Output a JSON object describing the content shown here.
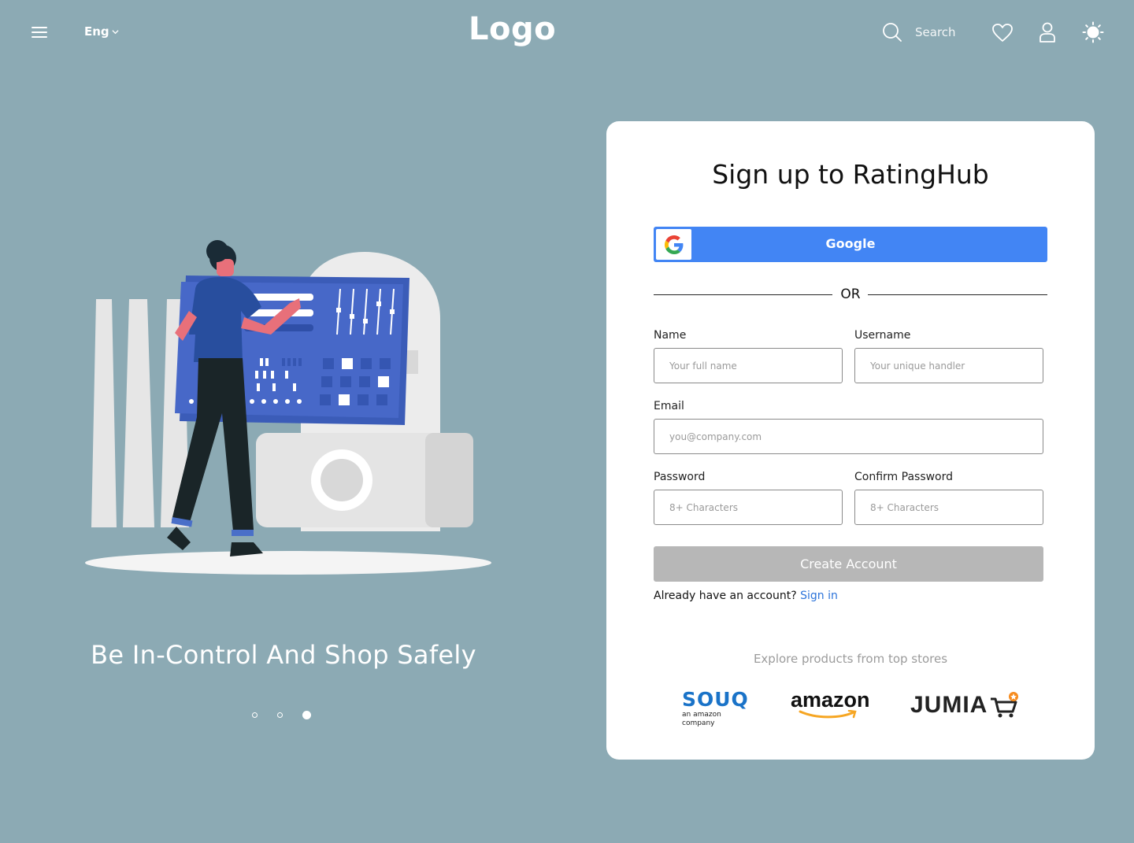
{
  "header": {
    "language": "Eng",
    "logo": "Logo",
    "search_placeholder": "Search"
  },
  "hero": {
    "title": "Be In-Control And Shop Safely",
    "carousel": {
      "total": 3,
      "active_index": 2
    }
  },
  "signup": {
    "title": "Sign up to RatingHub",
    "google_label": "Google",
    "or_label": "OR",
    "fields": {
      "name": {
        "label": "Name",
        "placeholder": "Your full name"
      },
      "username": {
        "label": "Username",
        "placeholder": "Your unique handler"
      },
      "email": {
        "label": "Email",
        "placeholder": "you@company.com"
      },
      "password": {
        "label": "Password",
        "placeholder": "8+ Characters"
      },
      "confirm_password": {
        "label": "Confirm Password",
        "placeholder": "8+ Characters"
      }
    },
    "create_label": "Create Account",
    "signin_prompt": "Already have an account?",
    "signin_link": "Sign in",
    "explore_text": "Explore products from top stores"
  },
  "stores": [
    {
      "name": "SOUQ",
      "tagline": "an amazon company"
    },
    {
      "name": "amazon"
    },
    {
      "name": "JUMIA"
    }
  ],
  "colors": {
    "background": "#8CAAB4",
    "google_blue": "#4285F4",
    "link_blue": "#2D74DA",
    "disabled_button": "#B7B7B7",
    "souq_blue": "#1A73C8",
    "amazon_orange": "#F6A623",
    "jumia_orange": "#F68B1E"
  },
  "icons": [
    "menu-icon",
    "chevron-down-icon",
    "search-icon",
    "heart-icon",
    "user-icon",
    "sun-icon",
    "google-g-icon"
  ]
}
